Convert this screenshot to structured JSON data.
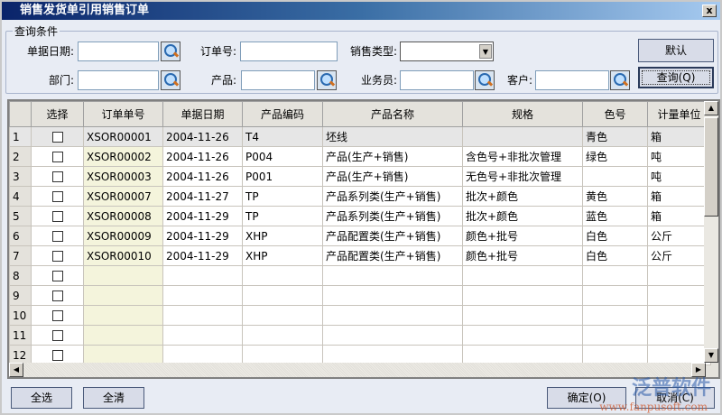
{
  "window": {
    "title": "销售发货单引用销售订单",
    "close": "x"
  },
  "query": {
    "group_label": "查询条件",
    "fields": {
      "date": "单据日期:",
      "order_no": "订单号:",
      "sales_type": "销售类型:",
      "dept": "部门:",
      "product": "产品:",
      "salesman": "业务员:",
      "customer": "客户:"
    },
    "values": {
      "date": "",
      "order_no": "",
      "sales_type": "",
      "dept": "",
      "product": "",
      "salesman": "",
      "customer": ""
    },
    "default_button": "默认",
    "query_button": "查询(Q)"
  },
  "grid": {
    "columns": [
      "",
      "选择",
      "订单单号",
      "单据日期",
      "产品编码",
      "产品名称",
      "规格",
      "色号",
      "计量单位"
    ],
    "rows": [
      [
        "1",
        "XSOR00001",
        "2004-11-26",
        "T4",
        "坯线",
        "",
        "青色",
        "箱"
      ],
      [
        "2",
        "XSOR00002",
        "2004-11-26",
        "P004",
        "产品(生产+销售)",
        "含色号+非批次管理",
        "绿色",
        "吨"
      ],
      [
        "3",
        "XSOR00003",
        "2004-11-26",
        "P001",
        "产品(生产+销售)",
        "无色号+非批次管理",
        "",
        "吨"
      ],
      [
        "4",
        "XSOR00007",
        "2004-11-27",
        "TP",
        "产品系列类(生产+销售)",
        "批次+颜色",
        "黄色",
        "箱"
      ],
      [
        "5",
        "XSOR00008",
        "2004-11-29",
        "TP",
        "产品系列类(生产+销售)",
        "批次+颜色",
        "蓝色",
        "箱"
      ],
      [
        "6",
        "XSOR00009",
        "2004-11-29",
        "XHP",
        "产品配置类(生产+销售)",
        "颜色+批号",
        "白色",
        "公斤"
      ],
      [
        "7",
        "XSOR00010",
        "2004-11-29",
        "XHP",
        "产品配置类(生产+销售)",
        "颜色+批号",
        "白色",
        "公斤"
      ],
      [
        "8",
        "",
        "",
        "",
        "",
        "",
        "",
        ""
      ],
      [
        "9",
        "",
        "",
        "",
        "",
        "",
        "",
        ""
      ],
      [
        "10",
        "",
        "",
        "",
        "",
        "",
        "",
        ""
      ],
      [
        "11",
        "",
        "",
        "",
        "",
        "",
        "",
        ""
      ],
      [
        "12",
        "",
        "",
        "",
        "",
        "",
        "",
        ""
      ]
    ]
  },
  "footer": {
    "select_all": "全选",
    "clear_all": "全清",
    "ok": "确定(O)",
    "cancel": "取消(C)"
  },
  "watermark": {
    "brand": "泛普软件",
    "url": "www.fanpusoft.com"
  }
}
